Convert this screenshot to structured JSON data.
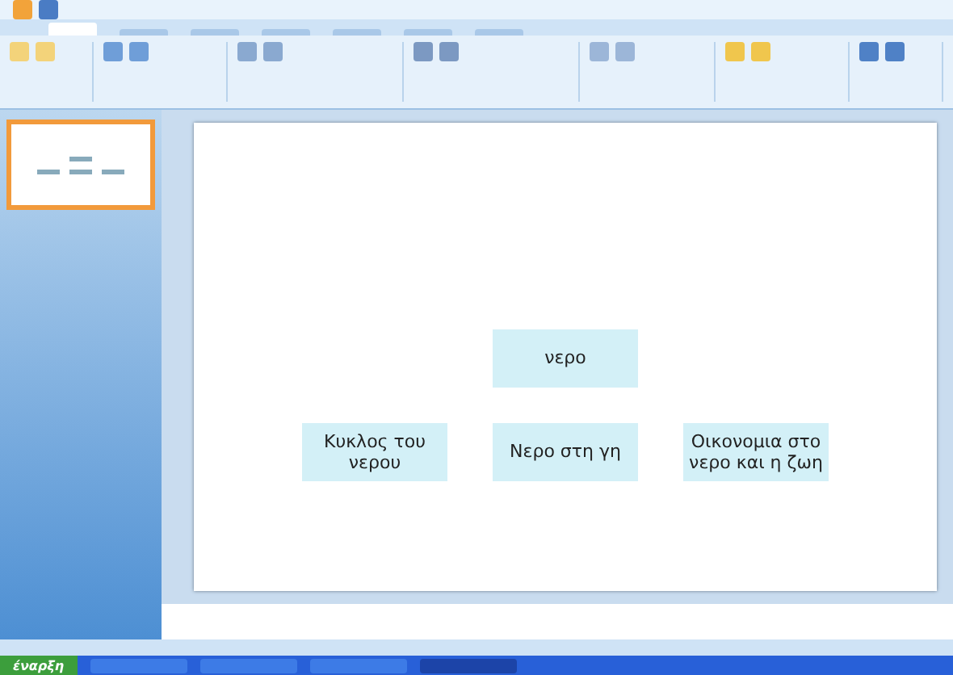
{
  "slide": {
    "top": "νερο",
    "children": [
      {
        "label": "Κυκλος του νερου"
      },
      {
        "label": "Νερο στη γη"
      },
      {
        "label": "Οικονομια στο νερο και η ζωη"
      }
    ]
  },
  "ribbon_tabs": [
    {
      "selected": true
    },
    {
      "selected": false
    },
    {
      "selected": false
    },
    {
      "selected": false
    },
    {
      "selected": false
    },
    {
      "selected": false
    },
    {
      "selected": false
    }
  ],
  "thumbnail": {
    "selected": true
  },
  "taskbar": {
    "start": "έναρξη",
    "items": [
      {
        "selected": false
      },
      {
        "selected": false
      },
      {
        "selected": false
      },
      {
        "selected": true
      }
    ]
  }
}
